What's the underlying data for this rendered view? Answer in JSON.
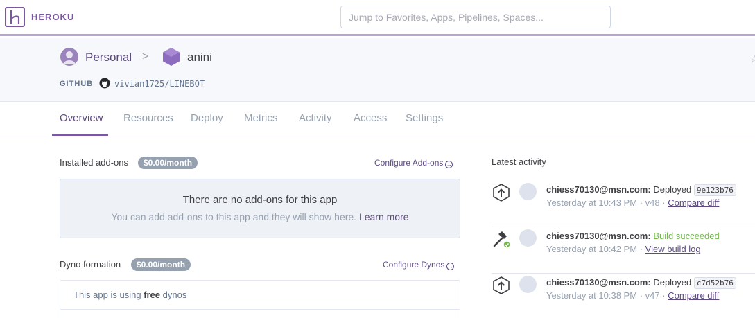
{
  "brand": {
    "name": "HEROKU",
    "accent": "#79589f"
  },
  "search": {
    "placeholder": "Jump to Favorites, Apps, Pipelines, Spaces..."
  },
  "breadcrumb": {
    "account": "Personal",
    "separator": ">",
    "app": "anini"
  },
  "github": {
    "label": "GITHUB",
    "repo": "vivian1725/LINEBOT"
  },
  "tabs": [
    {
      "label": "Overview",
      "active": true
    },
    {
      "label": "Resources"
    },
    {
      "label": "Deploy"
    },
    {
      "label": "Metrics"
    },
    {
      "label": "Activity"
    },
    {
      "label": "Access"
    },
    {
      "label": "Settings"
    }
  ],
  "addons": {
    "title": "Installed add-ons",
    "price": "$0.00/month",
    "configure": "Configure Add-ons",
    "empty_title": "There are no add-ons for this app",
    "empty_text": "You can add add-ons to this app and they will show here.",
    "learn_more": "Learn more"
  },
  "dynos": {
    "title": "Dyno formation",
    "price": "$0.00/month",
    "configure": "Configure Dynos",
    "text_prefix": "This app is using",
    "text_bold": "free",
    "text_suffix": "dynos"
  },
  "activity": {
    "title": "Latest activity",
    "items": [
      {
        "icon": "deploy-icon",
        "user": "chiess70130@msn.com:",
        "action": "Deployed",
        "hash": "9e123b76",
        "time": "Yesterday at 10:43 PM",
        "meta": "v48",
        "link": "Compare diff"
      },
      {
        "icon": "build-icon",
        "user": "chiess70130@msn.com:",
        "action": "Build succeeded",
        "time": "Yesterday at 10:42 PM",
        "link": "View build log"
      },
      {
        "icon": "deploy-icon",
        "user": "chiess70130@msn.com:",
        "action": "Deployed",
        "hash": "c7d52b76",
        "time": "Yesterday at 10:38 PM",
        "meta": "v47",
        "link": "Compare diff"
      }
    ]
  },
  "dot": "·"
}
